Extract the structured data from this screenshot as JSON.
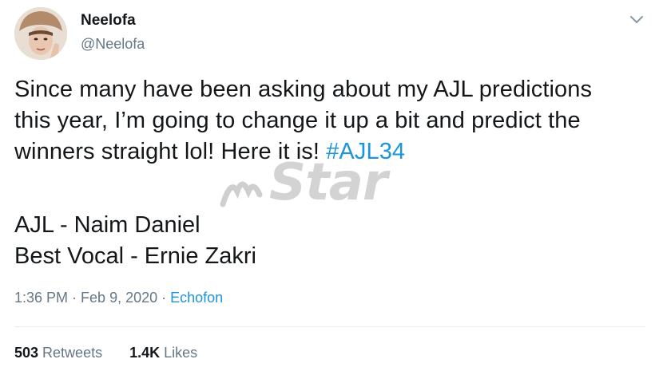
{
  "user": {
    "name": "Neelofa",
    "handle": "@Neelofa",
    "avatar": "avatar-photo"
  },
  "tweet": {
    "lines": [
      "Since many have been asking about my AJL predictions",
      "this year, I’m going to change it up a bit and predict the",
      "winners straight lol! Here it is! "
    ],
    "hashtag": "#AJL34",
    "predictions": [
      "AJL - Naim Daniel",
      "Best Vocal - Ernie Zakri"
    ]
  },
  "meta": {
    "time": "1:36 PM",
    "separator1": " · ",
    "date": "Feb 9, 2020",
    "separator2": " · ",
    "source": "Echofon"
  },
  "stats": {
    "retweets_count": "503",
    "retweets_label": " Retweets",
    "likes_count": "1.4K",
    "likes_label": " Likes"
  },
  "watermark": {
    "text": "Star"
  },
  "colors": {
    "text": "#14171a",
    "secondary": "#657786",
    "link": "#1b95e0",
    "divider": "#e6ecf0"
  },
  "icons": {
    "menu": "chevron-down-icon",
    "watermark_logo": "mstar-logo"
  }
}
